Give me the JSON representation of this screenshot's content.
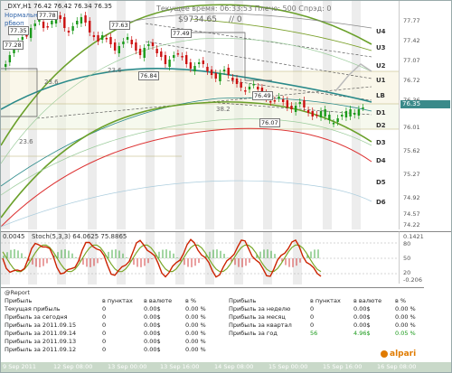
{
  "chart_header": {
    "symbol_info": "_DXY,H1  76.42 76.42 76.34 76.35",
    "left_caption_1": "Нормальный",
    "left_caption_2": "рбвоп",
    "server_time": "Текущее время: 06:33:53  Плечо: 500  Спрэд: 0",
    "balance": "$9734.65",
    "ratio": "// 0"
  },
  "price_axis": {
    "labels": [
      "77.77",
      "77.42",
      "77.07",
      "76.72",
      "76.36",
      "76.01",
      "75.62",
      "75.27",
      "74.92",
      "74.57",
      "74.22"
    ],
    "current_price": "76.35"
  },
  "levels": [
    {
      "label": "U4"
    },
    {
      "label": "U3"
    },
    {
      "label": "U2"
    },
    {
      "label": "U1"
    },
    {
      "label": "LB"
    },
    {
      "label": "D1"
    },
    {
      "label": "D2"
    },
    {
      "label": "D3"
    },
    {
      "label": "D4"
    },
    {
      "label": "D5"
    },
    {
      "label": "D6"
    }
  ],
  "chart_annotations": [
    {
      "text": "77.78"
    },
    {
      "text": "77.63"
    },
    {
      "text": "77.49"
    },
    {
      "text": "77.35"
    },
    {
      "text": "77.28"
    },
    {
      "text": "76.84"
    },
    {
      "text": "76.49"
    },
    {
      "text": "76.07"
    },
    {
      "text": "23.6"
    },
    {
      "text": "23.6"
    },
    {
      "text": "38.2"
    },
    {
      "text": "23.6"
    }
  ],
  "oscillator": {
    "title": "Stoch(5,3,3) 64.0625 75.8865",
    "prefix": "0.0045",
    "axis_labels": [
      "0.1421",
      "80",
      "50",
      "20",
      "-0.206"
    ]
  },
  "report": {
    "title": "@Report",
    "left_headers": [
      "в пунктах",
      "в валюте",
      "в %"
    ],
    "left_rows": [
      {
        "label": "Прибыль",
        "pts": "в пунктах",
        "cur": "в валюте",
        "pct": "в %"
      },
      {
        "label": "Текущая прибыль",
        "pts": "0",
        "cur": "0.00$",
        "pct": "0.00 %"
      },
      {
        "label": "Прибыль за сегодня",
        "pts": "0",
        "cur": "0.00$",
        "pct": "0.00 %"
      },
      {
        "label": "Прибыль за 2011.09.15",
        "pts": "0",
        "cur": "0.00$",
        "pct": "0.00 %"
      },
      {
        "label": "Прибыль за 2011.09.14",
        "pts": "0",
        "cur": "0.00$",
        "pct": "0.00 %"
      },
      {
        "label": "Прибыль за 2011.09.13",
        "pts": "0",
        "cur": "0.00$",
        "pct": "0.00 %"
      },
      {
        "label": "Прибыль за 2011.09.12",
        "pts": "0",
        "cur": "0.00$",
        "pct": "0.00 %"
      }
    ],
    "right_rows": [
      {
        "label": "Прибыль",
        "pts": "в пунктах",
        "cur": "в валюте",
        "pct": "в %"
      },
      {
        "label": "Прибыль за неделю",
        "pts": "0",
        "cur": "0.00$",
        "pct": "0.00 %"
      },
      {
        "label": "Прибыль за месяц",
        "pts": "0",
        "cur": "0.00$",
        "pct": "0.00 %"
      },
      {
        "label": "Прибыль за квартал",
        "pts": "0",
        "cur": "0.00$",
        "pct": "0.00 %"
      },
      {
        "label": "Прибыль за год",
        "pts": "56",
        "cur": "4.96$",
        "pct": "0.05 %"
      }
    ],
    "brand": "alpari"
  },
  "time_axis": {
    "labels": [
      "9 Sep 2011",
      "12 Sep 08:00",
      "13 Sep 00:00",
      "13 Sep 16:00",
      "14 Sep 08:00",
      "15 Sep 00:00",
      "15 Sep 16:00",
      "16 Sep 08:00"
    ]
  },
  "colors": {
    "bull_candle": "#1a9a1a",
    "bear_candle": "#cc1111",
    "ma_green": "#6aa02a",
    "ma_teal": "#2a8a8a",
    "ma_red": "#dd3333",
    "stoch_main": "#cc2200",
    "stoch_signal": "#7aa82a",
    "profit_green": "#1a9a1a"
  }
}
